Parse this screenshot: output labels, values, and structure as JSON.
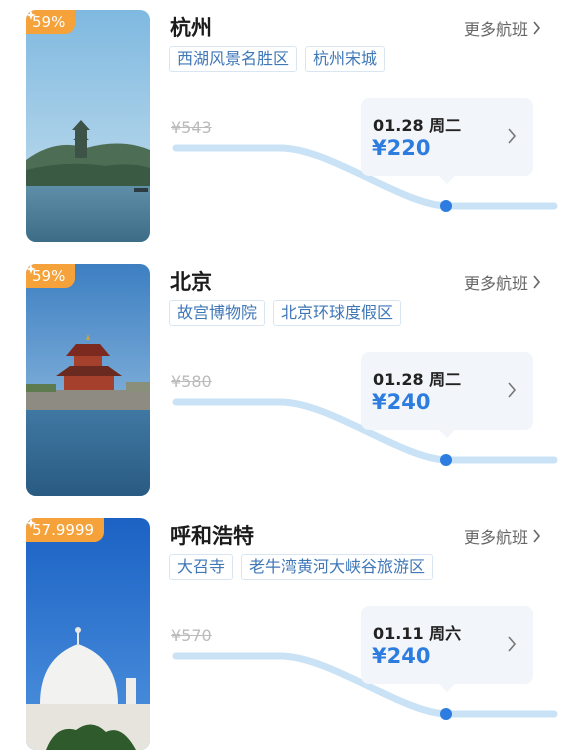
{
  "more_label": "更多航班",
  "colors": {
    "accent": "#2d7ce0",
    "discount_bg": "#f6a23b",
    "tag_text": "#3f77b7"
  },
  "destinations": [
    {
      "city": "杭州",
      "discount": "59%",
      "tags": [
        "西湖风景名胜区",
        "杭州宋城"
      ],
      "original_price": "¥543",
      "date": "01.28 周二",
      "price": "¥220",
      "image": "pagoda-lake"
    },
    {
      "city": "北京",
      "discount": "59%",
      "tags": [
        "故宫博物院",
        "北京环球度假区"
      ],
      "original_price": "¥580",
      "date": "01.28 周二",
      "price": "¥240",
      "image": "palace-corner-tower"
    },
    {
      "city": "呼和浩特",
      "discount": "57.9999",
      "tags": [
        "大召寺",
        "老牛湾黄河大峡谷旅游区"
      ],
      "original_price": "¥570",
      "date": "01.11 周六",
      "price": "¥240",
      "image": "white-mosque-dome"
    }
  ]
}
